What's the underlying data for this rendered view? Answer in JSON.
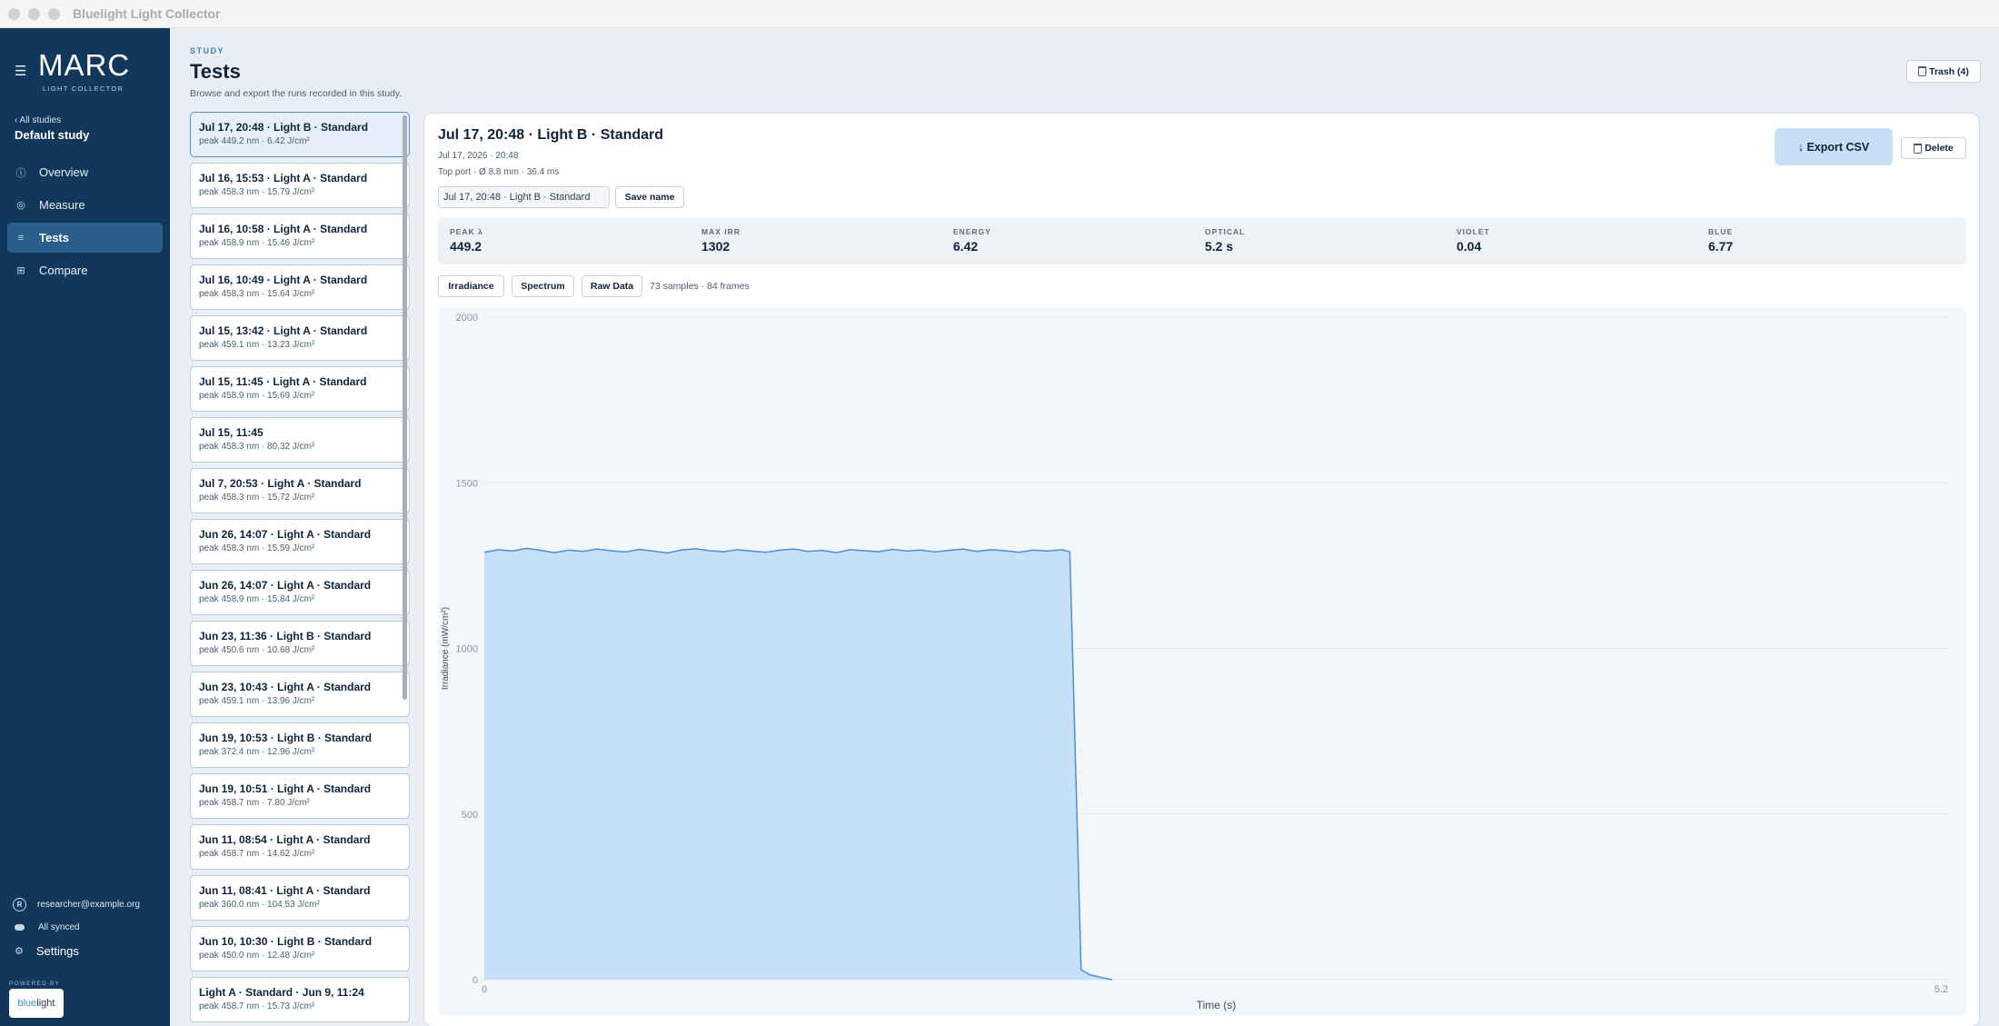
{
  "app": {
    "window_title": "Bluelight Light Collector"
  },
  "sidebar": {
    "logo": "MARC",
    "logo_sub": "LIGHT COLLECTOR",
    "all_studies": "‹ All studies",
    "study_name": "Default study",
    "nav": [
      {
        "label": "Overview",
        "icon": "info-icon"
      },
      {
        "label": "Measure",
        "icon": "target-icon"
      },
      {
        "label": "Tests",
        "icon": "list-icon",
        "active": true
      },
      {
        "label": "Compare",
        "icon": "grid-icon"
      }
    ],
    "user_email": "researcher@example.org",
    "user_initial": "R",
    "sync_status": "All synced",
    "settings": "Settings",
    "powered_by": "POWERED BY",
    "brand_a": "blue",
    "brand_b": "light"
  },
  "header": {
    "eyebrow": "STUDY",
    "title": "Tests",
    "description": "Browse and export the runs recorded in this study.",
    "trash": "Trash (4)"
  },
  "tests": [
    {
      "title": "Jul 17, 20:48 · Light B · Standard",
      "sub": "peak 449.2 nm · 6.42 J/cm²",
      "selected": true
    },
    {
      "title": "Jul 16, 15:53 · Light A · Standard",
      "sub": "peak 458.3 nm · 15.79 J/cm²"
    },
    {
      "title": "Jul 16, 10:58 · Light A · Standard",
      "sub": "peak 458.9 nm · 15.46 J/cm²"
    },
    {
      "title": "Jul 16, 10:49 · Light A · Standard",
      "sub": "peak 458.3 nm · 15.64 J/cm²"
    },
    {
      "title": "Jul 15, 13:42 · Light A · Standard",
      "sub": "peak 459.1 nm · 13.23 J/cm²"
    },
    {
      "title": "Jul 15, 11:45 · Light A · Standard",
      "sub": "peak 458.9 nm · 15.69 J/cm²"
    },
    {
      "title": "Jul 15, 11:45",
      "sub": "peak 458.3 nm · 80.32 J/cm²"
    },
    {
      "title": "Jul 7, 20:53 · Light A · Standard",
      "sub": "peak 458.3 nm · 15.72 J/cm²"
    },
    {
      "title": "Jun 26, 14:07 · Light A · Standard",
      "sub": "peak 458.3 nm · 15.59 J/cm²"
    },
    {
      "title": "Jun 26, 14:07 · Light A · Standard",
      "sub": "peak 458.9 nm · 15.84 J/cm²"
    },
    {
      "title": "Jun 23, 11:36 · Light B · Standard",
      "sub": "peak 450.6 nm · 10.68 J/cm²"
    },
    {
      "title": "Jun 23, 10:43 · Light A · Standard",
      "sub": "peak 459.1 nm · 13.96 J/cm²"
    },
    {
      "title": "Jun 19, 10:53 · Light B · Standard",
      "sub": "peak 372.4 nm · 12.96 J/cm²"
    },
    {
      "title": "Jun 19, 10:51 · Light A · Standard",
      "sub": "peak 458.7 nm · 7.80 J/cm²"
    },
    {
      "title": "Jun 11, 08:54 · Light A · Standard",
      "sub": "peak 458.7 nm · 14.62 J/cm²"
    },
    {
      "title": "Jun 11, 08:41 · Light A · Standard",
      "sub": "peak 360.0 nm · 104.53 J/cm²"
    },
    {
      "title": "Jun 10, 10:30 · Light B · Standard",
      "sub": "peak 450.0 nm · 12.48 J/cm²"
    },
    {
      "title": "Light A · Standard · Jun 9, 11:24",
      "sub": "peak 458.7 nm · 15.73 J/cm²"
    }
  ],
  "detail": {
    "title": "Jul 17, 20:48 · Light B · Standard",
    "date": "Jul 17, 2026 · 20:48",
    "meta": "Top port · Ø 8.8 mm · 36.4 ms",
    "name_value": "Jul 17, 20:48 · Light B · Standard",
    "save_label": "Save name",
    "export_label": "↓ Export CSV",
    "delete_label": "Delete",
    "metrics": [
      {
        "label": "PEAK λ",
        "value": "449.2"
      },
      {
        "label": "MAX IRR",
        "value": "1302"
      },
      {
        "label": "ENERGY",
        "value": "6.42"
      },
      {
        "label": "OPTICAL",
        "value": "5.2 s"
      },
      {
        "label": "VIOLET",
        "value": "0.04"
      },
      {
        "label": "BLUE",
        "value": "6.77"
      }
    ],
    "tabs": [
      "Irradiance",
      "Spectrum",
      "Raw Data"
    ],
    "sample_info": "73 samples · 84 frames"
  },
  "colors": {
    "accent": "#3b84c4",
    "sidebar": "#11385b",
    "fill": "#c5e0f7",
    "stroke": "#4a90d9"
  },
  "chart_data": {
    "type": "area",
    "xlabel": "Time (s)",
    "ylabel": "Irradiance (mW/cm²)",
    "xlim": [
      0,
      5.2
    ],
    "ylim": [
      0,
      2000
    ],
    "yticks": [
      "0",
      "500",
      "1000",
      "1500",
      "2000"
    ],
    "xticks": [
      "0",
      "5.2"
    ],
    "grid": true,
    "series": [
      {
        "x": [
          0.0,
          0.05,
          0.1,
          0.15,
          0.2,
          0.25,
          0.3,
          0.35,
          0.4,
          0.45,
          0.5,
          0.55,
          0.6,
          0.65,
          0.7,
          0.75,
          0.8,
          0.85,
          0.9,
          0.95,
          1.0,
          1.05,
          1.1,
          1.15,
          1.2,
          1.25,
          1.3,
          1.35,
          1.4,
          1.45,
          1.5,
          1.55,
          1.6,
          1.65,
          1.7,
          1.75,
          1.8,
          1.85,
          1.9,
          1.95,
          2.0,
          2.05,
          2.08,
          2.12,
          2.15,
          2.2,
          2.23
        ],
        "values": [
          1290,
          1298,
          1294,
          1302,
          1296,
          1289,
          1297,
          1293,
          1300,
          1295,
          1291,
          1299,
          1294,
          1288,
          1297,
          1301,
          1295,
          1292,
          1298,
          1294,
          1290,
          1297,
          1300,
          1293,
          1296,
          1289,
          1298,
          1295,
          1292,
          1299,
          1294,
          1297,
          1291,
          1296,
          1300,
          1293,
          1298,
          1295,
          1290,
          1297,
          1294,
          1298,
          1292,
          30,
          15,
          5,
          0
        ]
      }
    ]
  }
}
